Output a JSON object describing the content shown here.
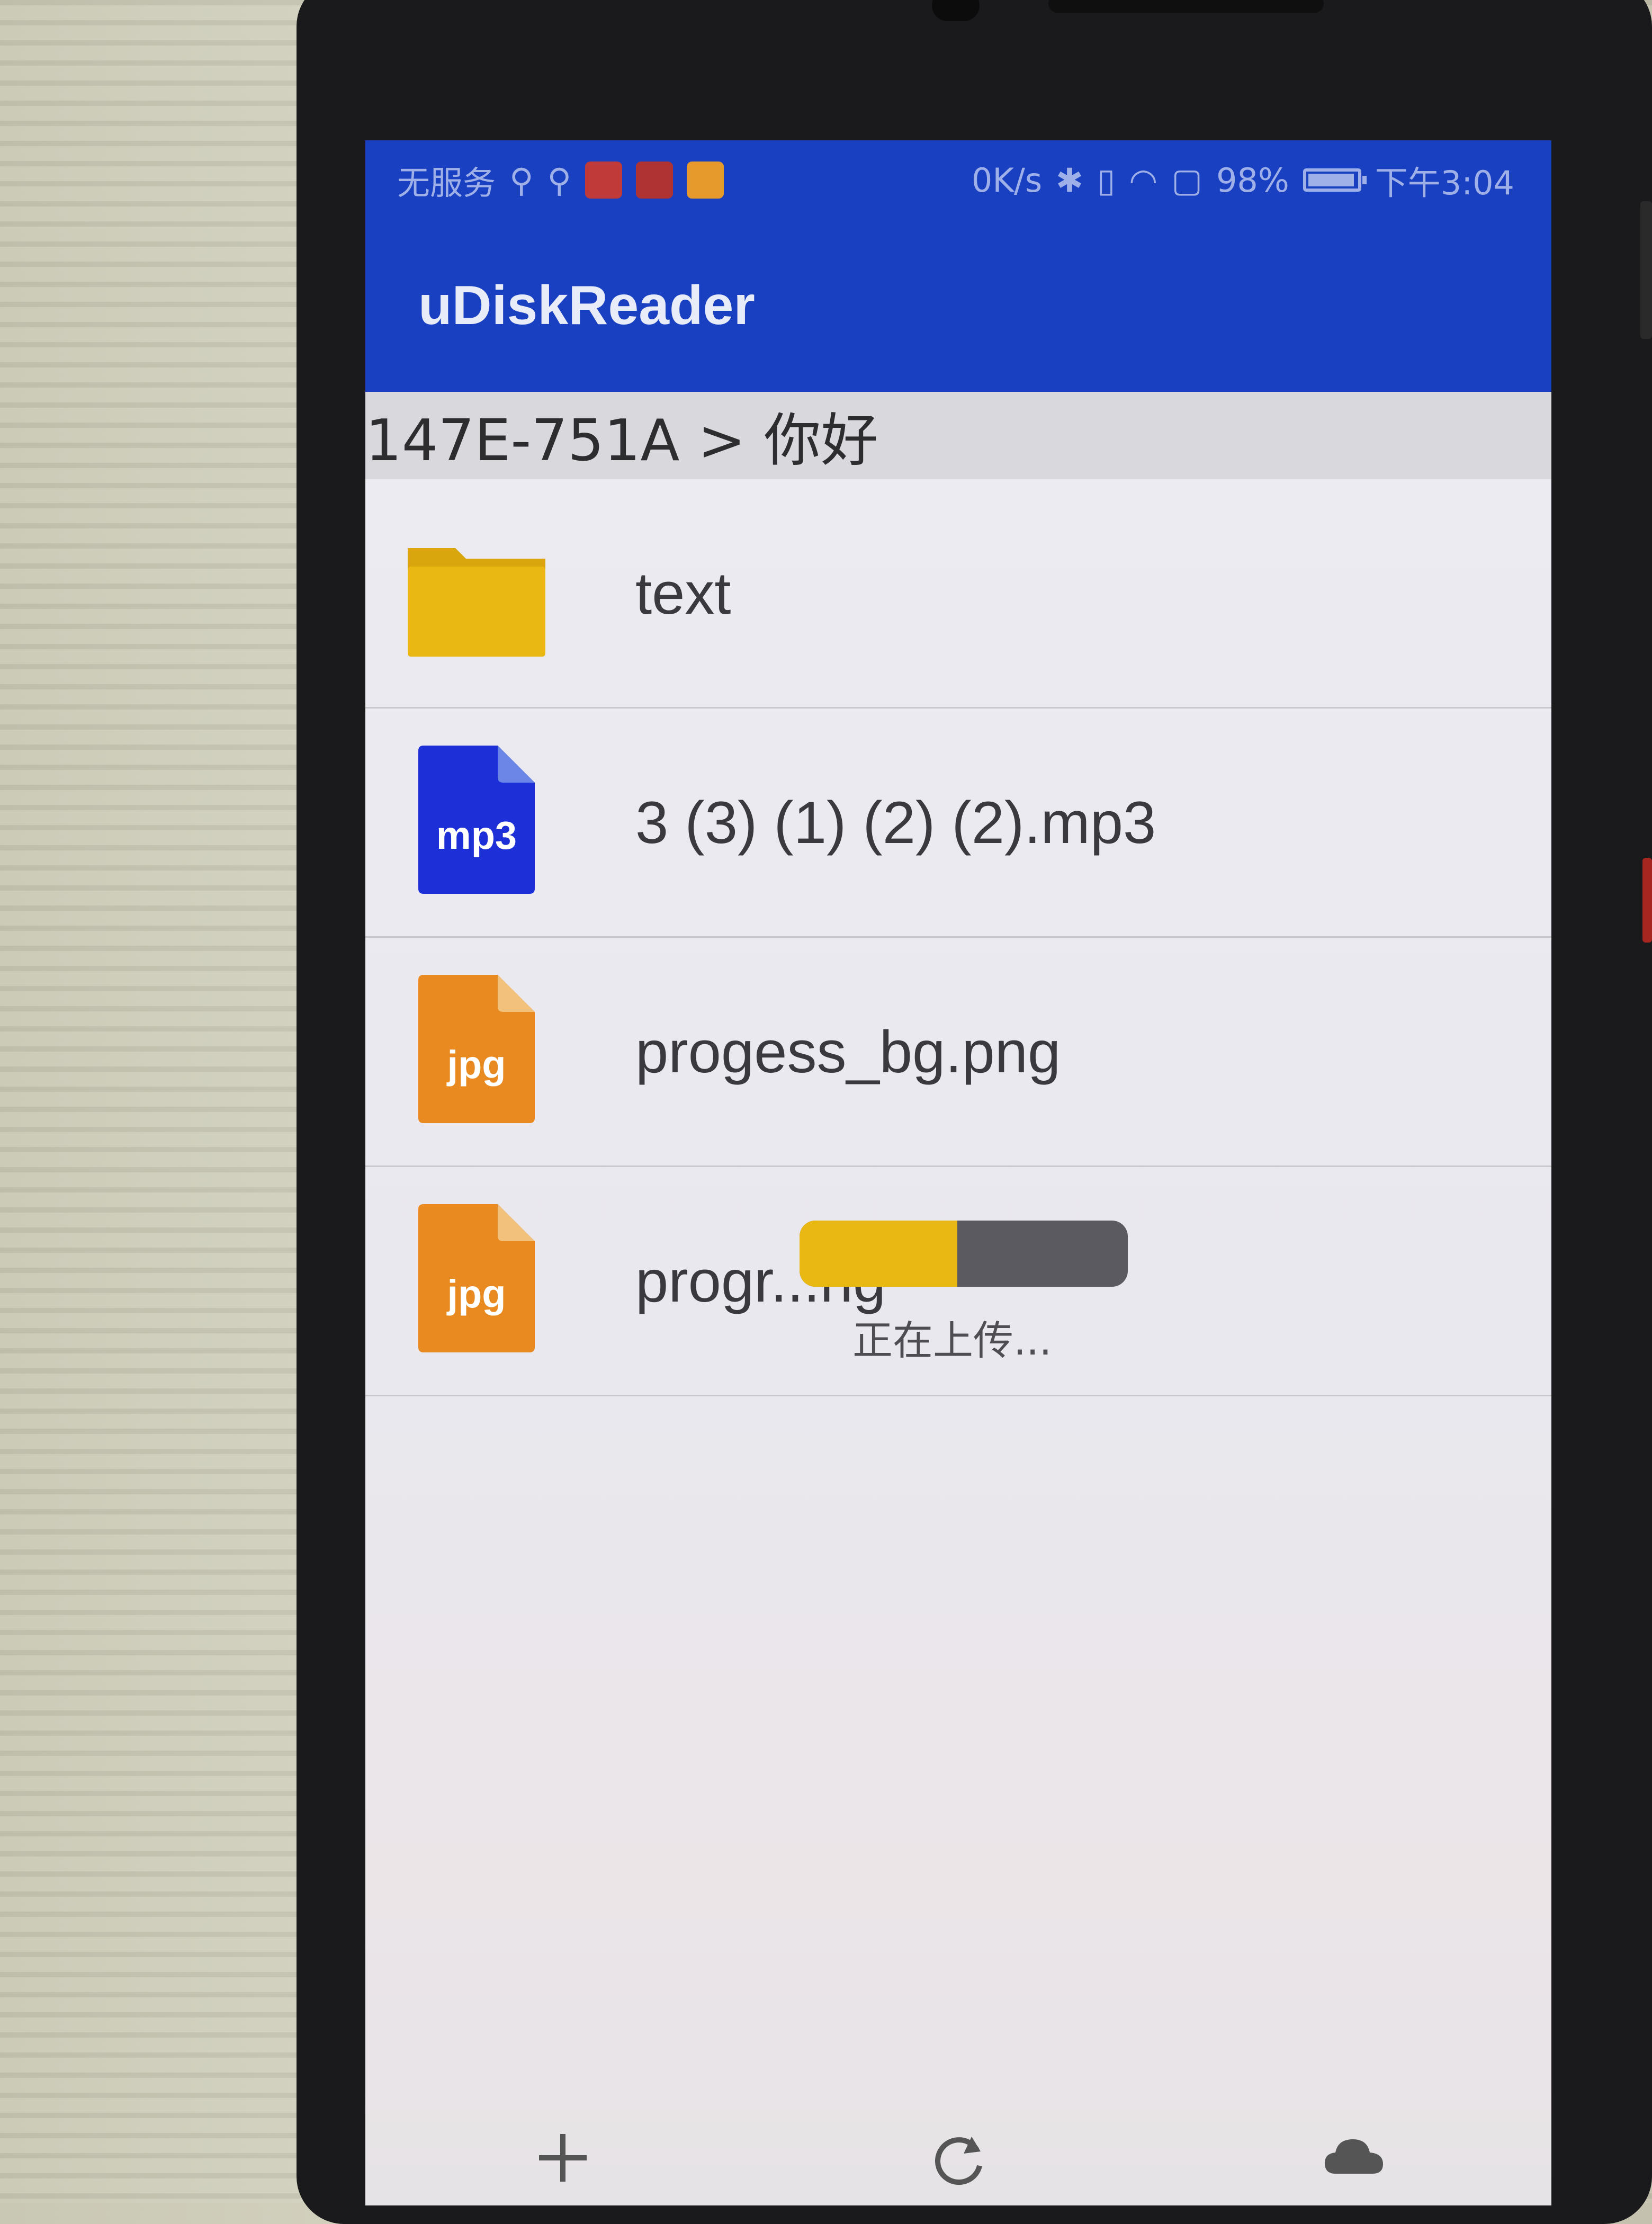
{
  "status_bar": {
    "carrier": "无服务",
    "net_speed": "0K/s",
    "battery_percent": "98%",
    "battery_level": 0.98,
    "time": "下午3:04"
  },
  "app": {
    "title": "uDiskReader"
  },
  "breadcrumb": "147E-751A > 你好",
  "files": [
    {
      "name": "text",
      "type": "folder",
      "icon": "folder-icon",
      "badge": ""
    },
    {
      "name": "3 (3) (1) (2) (2).mp3",
      "type": "mp3",
      "icon": "mp3-file-icon",
      "badge": "mp3"
    },
    {
      "name": "progess_bg.png",
      "type": "jpg",
      "icon": "jpg-file-icon",
      "badge": "jpg"
    },
    {
      "name": "progr...ng",
      "type": "jpg",
      "icon": "jpg-file-icon",
      "badge": "jpg"
    }
  ],
  "upload": {
    "label": "正在上传...",
    "progress": 0.48
  },
  "bottom_bar": {
    "icons": [
      "add-icon",
      "refresh-icon",
      "cloud-icon"
    ]
  },
  "colors": {
    "primary": "#1a40c2",
    "folder": "#eab812",
    "mp3": "#1d2fd6",
    "jpg": "#e88a1f"
  }
}
